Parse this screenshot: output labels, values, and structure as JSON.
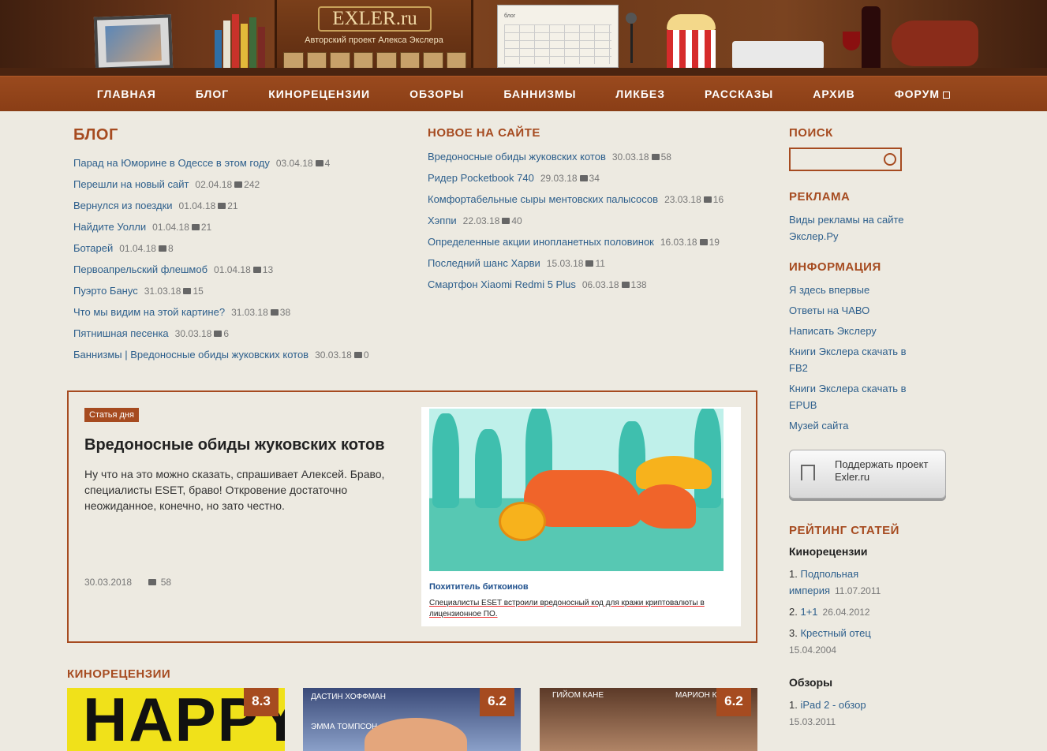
{
  "header": {
    "logo": "EXLER.ru",
    "subtitle": "Авторский проект Алекса Экслера",
    "calendar_label": "блог"
  },
  "nav": [
    "ГЛАВНАЯ",
    "БЛОГ",
    "КИНОРЕЦЕНЗИИ",
    "ОБЗОРЫ",
    "БАННИЗМЫ",
    "ЛИКБЕЗ",
    "РАССКАЗЫ",
    "АРХИВ",
    "ФОРУМ"
  ],
  "blog": {
    "title": "БЛОГ",
    "items": [
      {
        "title": "Парад на Юморине в Одессе в этом году",
        "date": "03.04.18",
        "comments": "4"
      },
      {
        "title": "Перешли на новый сайт",
        "date": "02.04.18",
        "comments": "242"
      },
      {
        "title": "Вернулся из поездки",
        "date": "01.04.18",
        "comments": "21"
      },
      {
        "title": "Найдите Уолли",
        "date": "01.04.18",
        "comments": "21"
      },
      {
        "title": "Ботарей",
        "date": "01.04.18",
        "comments": "8"
      },
      {
        "title": "Первоапрельский флешмоб",
        "date": "01.04.18",
        "comments": "13"
      },
      {
        "title": "Пуэрто Банус",
        "date": "31.03.18",
        "comments": "15"
      },
      {
        "title": "Что мы видим на этой картине?",
        "date": "31.03.18",
        "comments": "38"
      },
      {
        "title": "Пятнишная песенка",
        "date": "30.03.18",
        "comments": "6"
      },
      {
        "title": "Баннизмы | Вредоносные обиды  жуковских котов",
        "date": "30.03.18",
        "comments": "0"
      }
    ]
  },
  "news": {
    "title": "НОВОЕ НА САЙТЕ",
    "items": [
      {
        "title": "Вредоносные обиды  жуковских котов",
        "date": "30.03.18",
        "comments": "58"
      },
      {
        "title": "Ридер Pocketbook 740",
        "date": "29.03.18",
        "comments": "34"
      },
      {
        "title": "Комфортабельные сыры ментовских палысосов",
        "date": "23.03.18",
        "comments": "16"
      },
      {
        "title": "Хэппи",
        "date": "22.03.18",
        "comments": "40"
      },
      {
        "title": "Определенные акции инопланетных половинок",
        "date": "16.03.18",
        "comments": "19"
      },
      {
        "title": "Последний шанс Харви",
        "date": "15.03.18",
        "comments": "11"
      },
      {
        "title": "Смартфон Xiaomi Redmi 5 Plus",
        "date": "06.03.18",
        "comments": "138"
      }
    ]
  },
  "article": {
    "badge": "Статья дня",
    "title": "Вредоносные обиды  жуковских котов",
    "text": "Ну что на это можно сказать, спрашивает Алексей. Браво, специалисты ESET, браво! Откровение достаточно неожиданное, конечно, но зато честно.",
    "date": "30.03.2018",
    "comments": "58",
    "image_caption": "Похититель биткоинов",
    "image_sub": "Специалисты ESET встроили вредоносный код для кражи криптовалюты в лицензионное ПО."
  },
  "movies": {
    "title": "КИНОРЕЦЕНЗИИ",
    "cards": [
      {
        "poster_text": "HAPPY",
        "rating": "8.3"
      },
      {
        "poster_text": "ДАСТИН ХОФФМАН",
        "poster_text2": "ЭММА ТОМПСОН",
        "rating": "6.2"
      },
      {
        "poster_text": "ГИЙОМ КАНЕ",
        "poster_text2": "МАРИОН К",
        "rating": "6.2"
      }
    ]
  },
  "sidebar": {
    "search_title": "ПОИСК",
    "ads_title": "РЕКЛАМА",
    "ads_links": [
      "Виды рекламы на сайте Экслер.Ру"
    ],
    "info_title": "ИНФОРМАЦИЯ",
    "info_links": [
      "Я здесь впервые",
      "Ответы на ЧАВО",
      "Написать Экслеру",
      "Книги Экслера скачать в FB2",
      "Книги Экслера скачать в EPUB",
      "Музей сайта"
    ],
    "support": "Поддержать проект Exler.ru",
    "rating_title": "РЕЙТИНГ СТАТЕЙ",
    "rating_groups": [
      {
        "name": "Кинорецензии",
        "items": [
          {
            "n": "1.",
            "title": "Подпольная империя",
            "date": "11.07.2011"
          },
          {
            "n": "2.",
            "title": "1+1",
            "date": "26.04.2012"
          },
          {
            "n": "3.",
            "title": "Крестный отец",
            "date": "15.04.2004"
          }
        ]
      },
      {
        "name": "Обзоры",
        "items": [
          {
            "n": "1.",
            "title": "iPad 2 - обзор",
            "date": "15.03.2011"
          }
        ]
      }
    ]
  }
}
